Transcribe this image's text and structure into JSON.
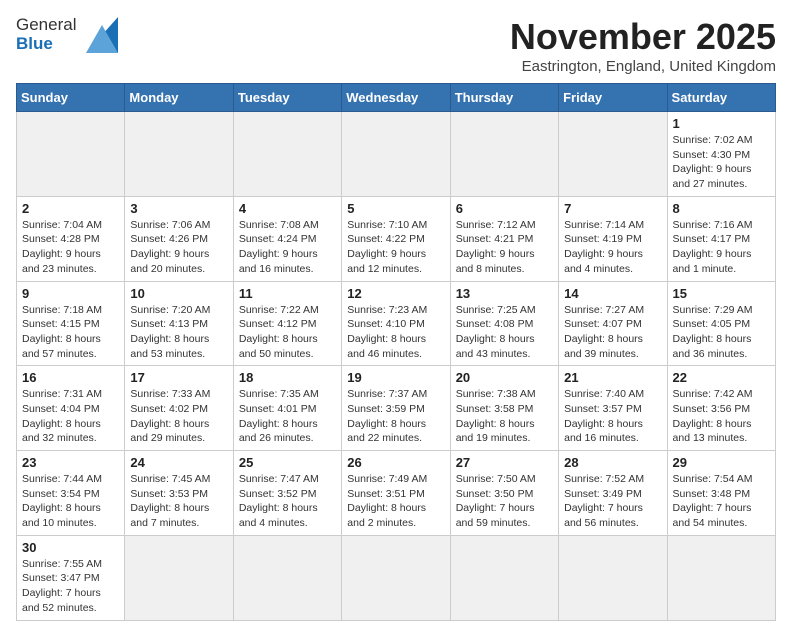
{
  "header": {
    "logo_line1": "General",
    "logo_line2": "Blue",
    "month_title": "November 2025",
    "location": "Eastrington, England, United Kingdom"
  },
  "weekdays": [
    "Sunday",
    "Monday",
    "Tuesday",
    "Wednesday",
    "Thursday",
    "Friday",
    "Saturday"
  ],
  "weeks": [
    [
      {
        "day": "",
        "info": "",
        "empty": true
      },
      {
        "day": "",
        "info": "",
        "empty": true
      },
      {
        "day": "",
        "info": "",
        "empty": true
      },
      {
        "day": "",
        "info": "",
        "empty": true
      },
      {
        "day": "",
        "info": "",
        "empty": true
      },
      {
        "day": "",
        "info": "",
        "empty": true
      },
      {
        "day": "1",
        "info": "Sunrise: 7:02 AM\nSunset: 4:30 PM\nDaylight: 9 hours and 27 minutes."
      }
    ],
    [
      {
        "day": "2",
        "info": "Sunrise: 7:04 AM\nSunset: 4:28 PM\nDaylight: 9 hours and 23 minutes."
      },
      {
        "day": "3",
        "info": "Sunrise: 7:06 AM\nSunset: 4:26 PM\nDaylight: 9 hours and 20 minutes."
      },
      {
        "day": "4",
        "info": "Sunrise: 7:08 AM\nSunset: 4:24 PM\nDaylight: 9 hours and 16 minutes."
      },
      {
        "day": "5",
        "info": "Sunrise: 7:10 AM\nSunset: 4:22 PM\nDaylight: 9 hours and 12 minutes."
      },
      {
        "day": "6",
        "info": "Sunrise: 7:12 AM\nSunset: 4:21 PM\nDaylight: 9 hours and 8 minutes."
      },
      {
        "day": "7",
        "info": "Sunrise: 7:14 AM\nSunset: 4:19 PM\nDaylight: 9 hours and 4 minutes."
      },
      {
        "day": "8",
        "info": "Sunrise: 7:16 AM\nSunset: 4:17 PM\nDaylight: 9 hours and 1 minute."
      }
    ],
    [
      {
        "day": "9",
        "info": "Sunrise: 7:18 AM\nSunset: 4:15 PM\nDaylight: 8 hours and 57 minutes."
      },
      {
        "day": "10",
        "info": "Sunrise: 7:20 AM\nSunset: 4:13 PM\nDaylight: 8 hours and 53 minutes."
      },
      {
        "day": "11",
        "info": "Sunrise: 7:22 AM\nSunset: 4:12 PM\nDaylight: 8 hours and 50 minutes."
      },
      {
        "day": "12",
        "info": "Sunrise: 7:23 AM\nSunset: 4:10 PM\nDaylight: 8 hours and 46 minutes."
      },
      {
        "day": "13",
        "info": "Sunrise: 7:25 AM\nSunset: 4:08 PM\nDaylight: 8 hours and 43 minutes."
      },
      {
        "day": "14",
        "info": "Sunrise: 7:27 AM\nSunset: 4:07 PM\nDaylight: 8 hours and 39 minutes."
      },
      {
        "day": "15",
        "info": "Sunrise: 7:29 AM\nSunset: 4:05 PM\nDaylight: 8 hours and 36 minutes."
      }
    ],
    [
      {
        "day": "16",
        "info": "Sunrise: 7:31 AM\nSunset: 4:04 PM\nDaylight: 8 hours and 32 minutes."
      },
      {
        "day": "17",
        "info": "Sunrise: 7:33 AM\nSunset: 4:02 PM\nDaylight: 8 hours and 29 minutes."
      },
      {
        "day": "18",
        "info": "Sunrise: 7:35 AM\nSunset: 4:01 PM\nDaylight: 8 hours and 26 minutes."
      },
      {
        "day": "19",
        "info": "Sunrise: 7:37 AM\nSunset: 3:59 PM\nDaylight: 8 hours and 22 minutes."
      },
      {
        "day": "20",
        "info": "Sunrise: 7:38 AM\nSunset: 3:58 PM\nDaylight: 8 hours and 19 minutes."
      },
      {
        "day": "21",
        "info": "Sunrise: 7:40 AM\nSunset: 3:57 PM\nDaylight: 8 hours and 16 minutes."
      },
      {
        "day": "22",
        "info": "Sunrise: 7:42 AM\nSunset: 3:56 PM\nDaylight: 8 hours and 13 minutes."
      }
    ],
    [
      {
        "day": "23",
        "info": "Sunrise: 7:44 AM\nSunset: 3:54 PM\nDaylight: 8 hours and 10 minutes."
      },
      {
        "day": "24",
        "info": "Sunrise: 7:45 AM\nSunset: 3:53 PM\nDaylight: 8 hours and 7 minutes."
      },
      {
        "day": "25",
        "info": "Sunrise: 7:47 AM\nSunset: 3:52 PM\nDaylight: 8 hours and 4 minutes."
      },
      {
        "day": "26",
        "info": "Sunrise: 7:49 AM\nSunset: 3:51 PM\nDaylight: 8 hours and 2 minutes."
      },
      {
        "day": "27",
        "info": "Sunrise: 7:50 AM\nSunset: 3:50 PM\nDaylight: 7 hours and 59 minutes."
      },
      {
        "day": "28",
        "info": "Sunrise: 7:52 AM\nSunset: 3:49 PM\nDaylight: 7 hours and 56 minutes."
      },
      {
        "day": "29",
        "info": "Sunrise: 7:54 AM\nSunset: 3:48 PM\nDaylight: 7 hours and 54 minutes."
      }
    ],
    [
      {
        "day": "30",
        "info": "Sunrise: 7:55 AM\nSunset: 3:47 PM\nDaylight: 7 hours and 52 minutes."
      },
      {
        "day": "",
        "info": "",
        "empty": true
      },
      {
        "day": "",
        "info": "",
        "empty": true
      },
      {
        "day": "",
        "info": "",
        "empty": true
      },
      {
        "day": "",
        "info": "",
        "empty": true
      },
      {
        "day": "",
        "info": "",
        "empty": true
      },
      {
        "day": "",
        "info": "",
        "empty": true
      }
    ]
  ]
}
